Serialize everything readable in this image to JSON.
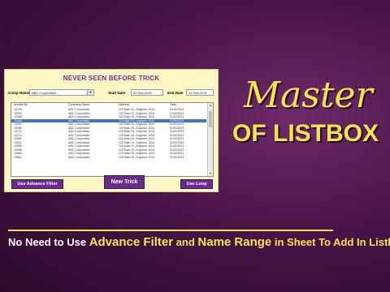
{
  "card": {
    "title": "NEVER SEEN BEFORE TRICK",
    "comp_label": "Comp Name",
    "comp_value": "ABC Corporation",
    "start_label": "Start Date",
    "start_value": "01-Feb-2020",
    "end_label": "End Date",
    "end_value": "01-Feb-2021"
  },
  "list": {
    "headers": [
      "Invoice No",
      "Company Name",
      "Address",
      "Date"
    ],
    "rows": [
      [
        "12126",
        "ABC Corporation",
        "123 Main St., Anytown, USA",
        "01/02/2021"
      ],
      [
        "15294",
        "ABC Corporation",
        "123 Main St., Anytown, USA",
        "01/02/2021"
      ],
      [
        "10458",
        "ABC Corporation",
        "123 Main St., Anytown, USA",
        "01/02/2021"
      ],
      [
        "15466",
        "ABC Corporation",
        "123 Main St., Anytown, USA",
        "01/02/2021"
      ],
      [
        "11651",
        "ABC Corporation",
        "123 Main St., Anytown, USA",
        "01/02/2021"
      ],
      [
        "15998",
        "ABC Corporation",
        "123 Main St., Anytown, USA",
        "01/02/2021"
      ],
      [
        "14722",
        "ABC Corporation",
        "123 Main St., Anytown, USA",
        "01/02/2021"
      ],
      [
        "14714",
        "ABC Corporation",
        "123 Main St., Anytown, USA",
        "01/02/2021"
      ],
      [
        "11846",
        "ABC Corporation",
        "123 Main St., Anytown, USA",
        "01/02/2021"
      ],
      [
        "13001",
        "ABC Corporation",
        "123 Main St., Anytown, USA",
        "01/02/2021"
      ],
      [
        "12505",
        "ABC Corporation",
        "123 Main St., Anytown, USA",
        "01/02/2021"
      ],
      [
        "10956",
        "ABC Corporation",
        "123 Main St., Anytown, USA",
        "01/02/2021"
      ],
      [
        "15964",
        "ABC Corporation",
        "123 Main St., Anytown, USA",
        "01/02/2021"
      ],
      [
        "13561",
        "ABC Corporation",
        "123 Main St., Anytown, USA",
        "01/02/2021"
      ]
    ],
    "selected_index": 3
  },
  "buttons": {
    "advance_filter": "Use Advance Filter",
    "new_trick": "New Trick",
    "use_loop": "Use Loop"
  },
  "hero": {
    "master": "Master",
    "of_listbox": "OF LISTBOX"
  },
  "bottom": {
    "part1": "No Need to Use ",
    "part2": "Advance Filter",
    "part3": " and ",
    "part4": "Name Range",
    "part5": " in Sheet To Add In Listbox"
  },
  "colors": {
    "accent_yellow": "#f6e54b",
    "button_purple": "#6b2a8e",
    "card_bg": "#fdf7c3",
    "selection_blue": "#3b73d9"
  }
}
